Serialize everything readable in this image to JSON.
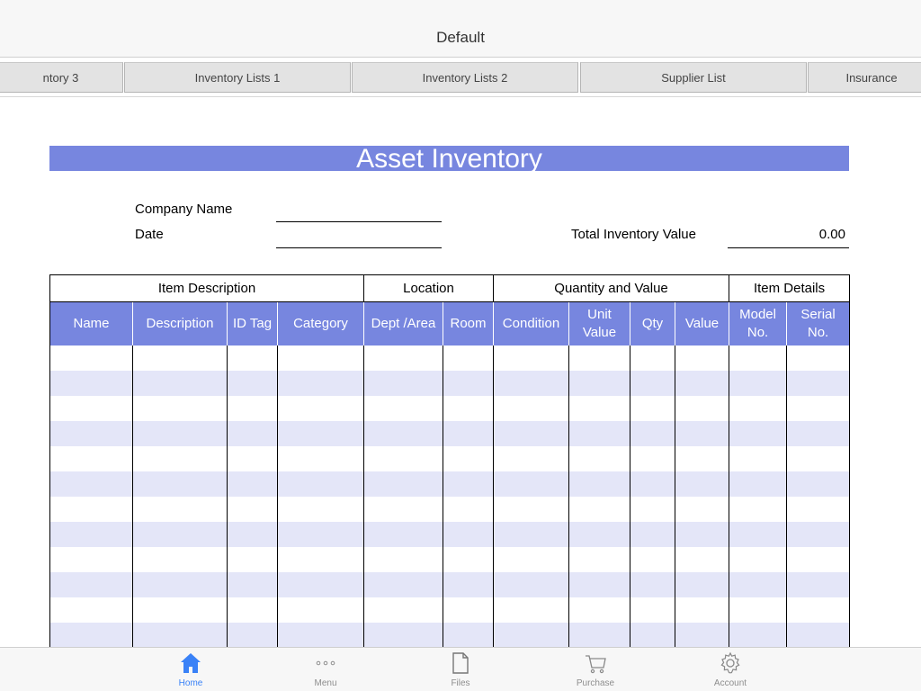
{
  "window": {
    "title": "Default"
  },
  "tabs": [
    "ntory 3",
    "Inventory Lists 1",
    "Inventory Lists 2",
    "Supplier List",
    "Insurance"
  ],
  "sheet": {
    "title": "Asset Inventory",
    "company_label": "Company Name",
    "date_label": "Date",
    "total_label": "Total Inventory Value",
    "total_value": "0.00"
  },
  "table": {
    "groups": [
      "Item Description",
      "Location",
      "Quantity and Value",
      "Item Details"
    ],
    "columns": [
      [
        "Name"
      ],
      [
        "Description"
      ],
      [
        "ID Tag"
      ],
      [
        "Category"
      ],
      [
        "Dept /Area"
      ],
      [
        "Room"
      ],
      [
        "Condition"
      ],
      [
        "Unit",
        "Value"
      ],
      [
        "Qty"
      ],
      [
        "Value"
      ],
      [
        "Model",
        "No."
      ],
      [
        "Serial",
        "No."
      ]
    ]
  },
  "bottom_nav": [
    {
      "label": "Home",
      "icon": "home-icon",
      "active": true
    },
    {
      "label": "Menu",
      "icon": "more-icon",
      "active": false
    },
    {
      "label": "Files",
      "icon": "file-icon",
      "active": false
    },
    {
      "label": "Purchase",
      "icon": "cart-icon",
      "active": false
    },
    {
      "label": "Account",
      "icon": "gear-icon",
      "active": false
    }
  ],
  "colors": {
    "accent": "#7786df",
    "band": "#e4e6f8",
    "active_nav": "#3a82f7",
    "inactive_nav": "#8e8e8e"
  }
}
